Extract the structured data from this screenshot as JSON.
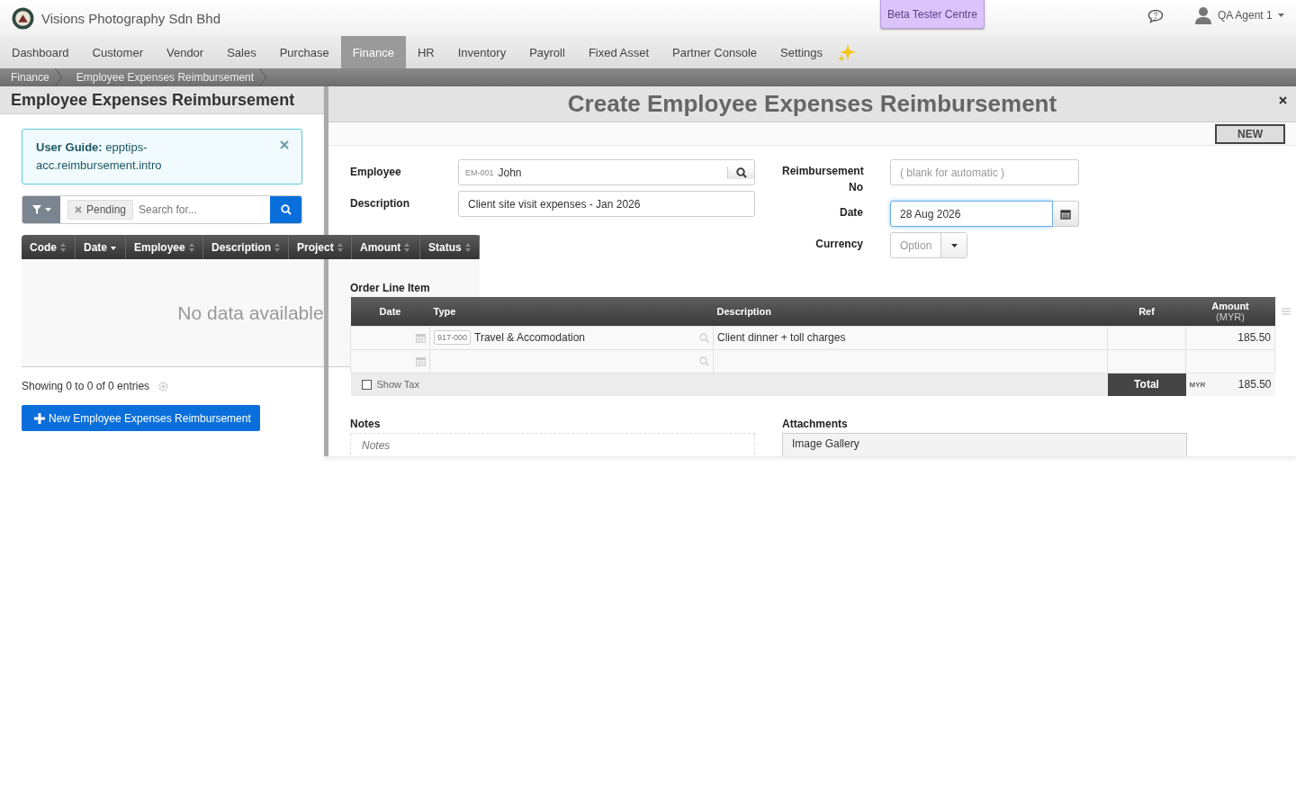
{
  "app": {
    "company": "Visions Photography Sdn Bhd",
    "beta_button": "Beta Tester Centre",
    "user": "QA Agent 1"
  },
  "nav": [
    {
      "label": "Dashboard",
      "selected": false
    },
    {
      "label": "Customer",
      "selected": false
    },
    {
      "label": "Vendor",
      "selected": false
    },
    {
      "label": "Sales",
      "selected": false
    },
    {
      "label": "Purchase",
      "selected": false
    },
    {
      "label": "Finance",
      "selected": true
    },
    {
      "label": "HR",
      "selected": false
    },
    {
      "label": "Inventory",
      "selected": false
    },
    {
      "label": "Payroll",
      "selected": false
    },
    {
      "label": "Fixed Asset",
      "selected": false
    },
    {
      "label": "Partner Console",
      "selected": false
    },
    {
      "label": "Settings",
      "selected": false
    }
  ],
  "breadcrumb": [
    "Finance",
    "Employee Expenses Reimbursement"
  ],
  "list_panel": {
    "title": "Employee Expenses Reimbursement",
    "guide": "**User Guide:** epptips-acc.reimbursement.intro",
    "filter_chip": "Pending",
    "search_placeholder": "Search for...",
    "columns": [
      {
        "label": "Code",
        "sorted": false
      },
      {
        "label": "Date",
        "sorted": true
      },
      {
        "label": "Employee",
        "sorted": false
      },
      {
        "label": "Description",
        "sorted": false
      },
      {
        "label": "Project",
        "sorted": false
      },
      {
        "label": "Amount",
        "sorted": false
      },
      {
        "label": "Status",
        "sorted": false
      }
    ],
    "empty_text": "No data available",
    "info": "Showing 0 to 0 of 0 entries",
    "new_button": "New Employee Expenses Reimbursement"
  },
  "form": {
    "title": "Create Employee Expenses Reimbursement",
    "mode_button": "NEW",
    "employee": {
      "label": "Employee",
      "code": "EM-001",
      "value": "John"
    },
    "description": {
      "label": "Description",
      "value": "Client site visit expenses - Jan 2026"
    },
    "reimbursement_no": {
      "label": "Reimbursement No",
      "placeholder": "( blank for automatic )"
    },
    "date": {
      "label": "Date",
      "value": "28 Aug 2026",
      "focused": true
    },
    "currency": {
      "label": "Currency",
      "placeholder": "Option"
    },
    "order_lines": {
      "title": "Order Line Item",
      "columns": [
        {
          "label": "Date"
        },
        {
          "label": "Type"
        },
        {
          "label": "Description"
        },
        {
          "label": "Ref"
        },
        {
          "label": "Amount",
          "sub": "(MYR)"
        }
      ],
      "rows": [
        {
          "date": "",
          "type_code": "917-000",
          "type": "Travel & Accomodation",
          "description": "Client dinner + toll charges",
          "ref": "",
          "amount": "185.50"
        },
        {
          "date": "",
          "type_code": "",
          "type": "",
          "description": "",
          "ref": "",
          "amount": ""
        }
      ],
      "show_tax": {
        "label": "Show Tax",
        "checked": false
      },
      "total": {
        "label": "Total",
        "currency": "MYR",
        "value": "185.50"
      }
    },
    "notes": {
      "label": "Notes",
      "placeholder": "Notes"
    },
    "attachments": {
      "label": "Attachments",
      "gallery": "Image Gallery"
    }
  }
}
